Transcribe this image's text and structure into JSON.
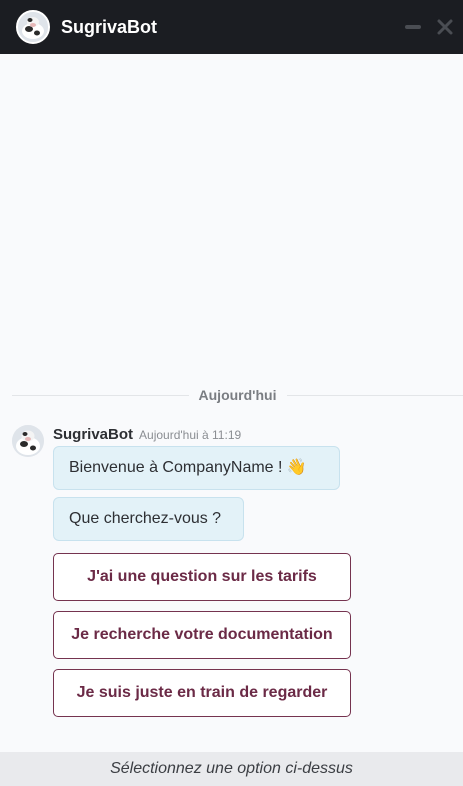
{
  "header": {
    "title": "SugrivaBot",
    "avatar_icon": "cow-avatar-icon",
    "minimize_icon": "minimize-icon",
    "close_icon": "close-icon"
  },
  "date_separator": "Aujourd'hui",
  "message": {
    "sender": "SugrivaBot",
    "time": "Aujourd'hui à 11:19",
    "bubbles": [
      "Bienvenue à CompanyName ! 👋",
      "Que cherchez-vous ?"
    ]
  },
  "options": [
    "J'ai une question sur les tarifs",
    "Je recherche votre documentation",
    "Je suis juste en train de regarder"
  ],
  "footer": {
    "hint": "Sélectionnez une option ci-dessus"
  },
  "colors": {
    "header_bg": "#1b1d22",
    "bubble_bg": "#e3f2f8",
    "option_border": "#75334f",
    "option_text": "#6b2a46",
    "footer_bg": "#e9eaed"
  }
}
